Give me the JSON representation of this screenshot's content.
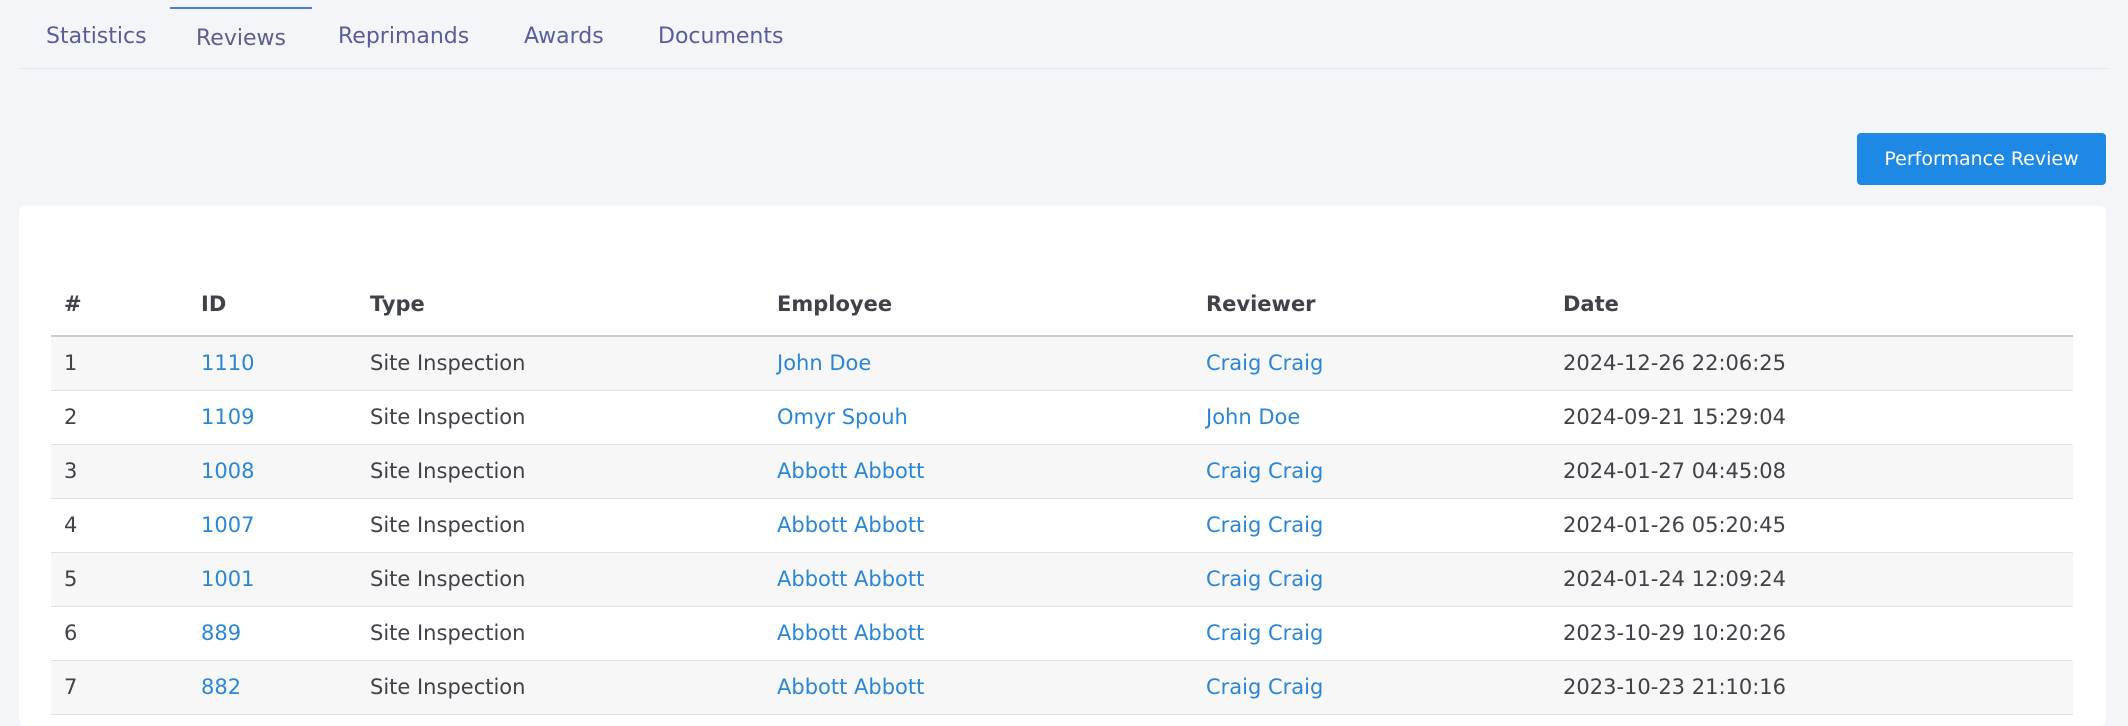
{
  "tabs": [
    {
      "label": "Statistics"
    },
    {
      "label": "Reviews",
      "active": true
    },
    {
      "label": "Reprimands"
    },
    {
      "label": "Awards"
    },
    {
      "label": "Documents"
    }
  ],
  "toolbar": {
    "performance_review_label": "Performance Review"
  },
  "table": {
    "headers": [
      "#",
      "ID",
      "Type",
      "Employee",
      "Reviewer",
      "Date"
    ],
    "rows": [
      {
        "num": "1",
        "id": "1110",
        "type": "Site Inspection",
        "employee": "John Doe",
        "reviewer": "Craig Craig",
        "date": "2024-12-26 22:06:25"
      },
      {
        "num": "2",
        "id": "1109",
        "type": "Site Inspection",
        "employee": "Omyr Spouh",
        "reviewer": "John Doe",
        "date": "2024-09-21 15:29:04"
      },
      {
        "num": "3",
        "id": "1008",
        "type": "Site Inspection",
        "employee": "Abbott Abbott",
        "reviewer": "Craig Craig",
        "date": "2024-01-27 04:45:08"
      },
      {
        "num": "4",
        "id": "1007",
        "type": "Site Inspection",
        "employee": "Abbott Abbott",
        "reviewer": "Craig Craig",
        "date": "2024-01-26 05:20:45"
      },
      {
        "num": "5",
        "id": "1001",
        "type": "Site Inspection",
        "employee": "Abbott Abbott",
        "reviewer": "Craig Craig",
        "date": "2024-01-24 12:09:24"
      },
      {
        "num": "6",
        "id": "889",
        "type": "Site Inspection",
        "employee": "Abbott Abbott",
        "reviewer": "Craig Craig",
        "date": "2023-10-29 10:20:26"
      },
      {
        "num": "7",
        "id": "882",
        "type": "Site Inspection",
        "employee": "Abbott Abbott",
        "reviewer": "Craig Craig",
        "date": "2023-10-23 21:10:16"
      }
    ]
  },
  "colors": {
    "accent": "#1e88e5",
    "link": "#2a86d6",
    "tab_text": "#5a5c9e"
  }
}
